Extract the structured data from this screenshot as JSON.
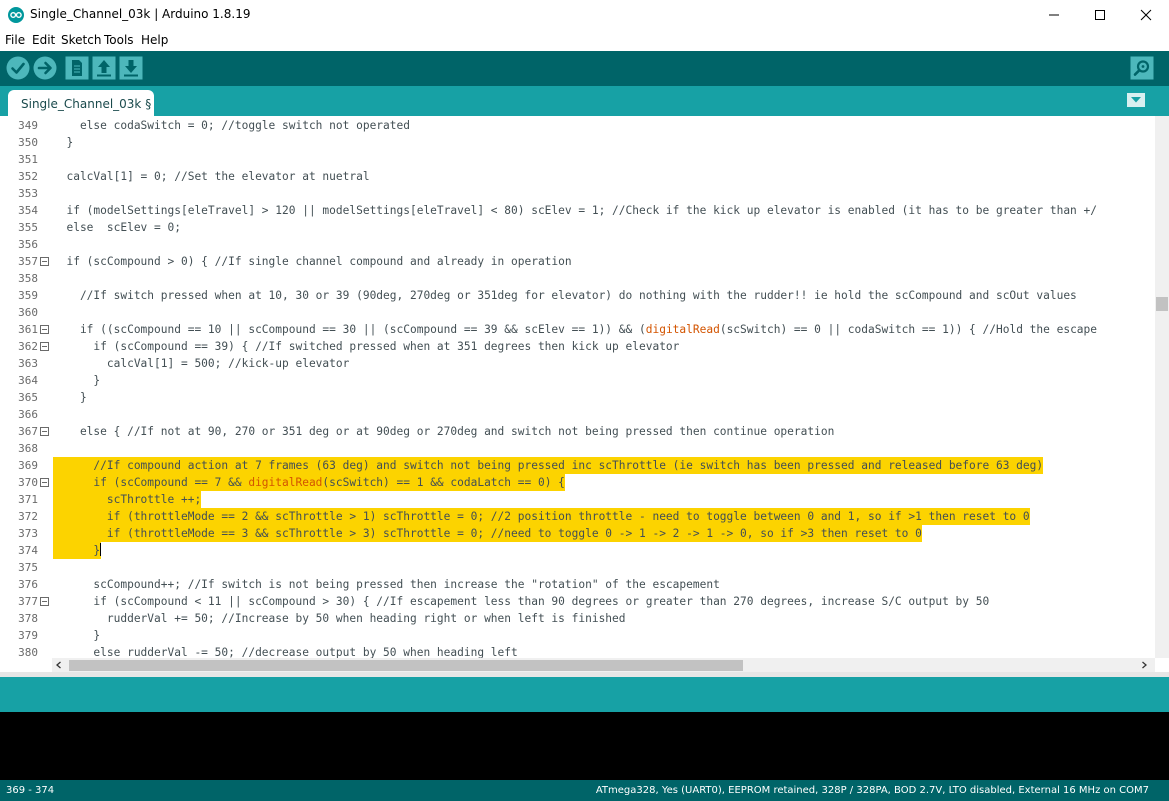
{
  "window": {
    "title": "Single_Channel_03k | Arduino 1.8.19",
    "app_icon": "arduino-logo-icon",
    "controls": [
      "minimize-icon",
      "maximize-icon",
      "close-icon"
    ]
  },
  "menu": {
    "items": [
      "File",
      "Edit",
      "Sketch",
      "Tools",
      "Help"
    ]
  },
  "toolbar": {
    "buttons": [
      {
        "name": "verify",
        "icon": "checkmark-icon"
      },
      {
        "name": "upload",
        "icon": "arrow-right-icon"
      },
      {
        "name": "new",
        "icon": "new-file-icon"
      },
      {
        "name": "open",
        "icon": "arrow-up-icon"
      },
      {
        "name": "save",
        "icon": "arrow-down-icon"
      }
    ],
    "serial_monitor_icon": "magnifier-icon"
  },
  "tabs": [
    {
      "label": "Single_Channel_03k §",
      "active": true
    }
  ],
  "editor": {
    "lines": [
      {
        "num": "349",
        "text": "    else codaSwitch = 0; //toggle switch not operated"
      },
      {
        "num": "350",
        "text": "  }"
      },
      {
        "num": "351",
        "text": ""
      },
      {
        "num": "352",
        "text": "  calcVal[1] = 0; //Set the elevator at nuetral"
      },
      {
        "num": "353",
        "text": ""
      },
      {
        "num": "354",
        "text": "  if (modelSettings[eleTravel] > 120 || modelSettings[eleTravel] < 80) scElev = 1; //Check if the kick up elevator is enabled (it has to be greater than +/"
      },
      {
        "num": "355",
        "text": "  else  scElev = 0;"
      },
      {
        "num": "356",
        "text": ""
      },
      {
        "num": "357",
        "text": "  if (scCompound > 0) { //If single channel compound and already in operation",
        "fold": true
      },
      {
        "num": "358",
        "text": ""
      },
      {
        "num": "359",
        "text": "    //If switch pressed when at 10, 30 or 39 (90deg, 270deg or 351deg for elevator) do nothing with the rudder!! ie hold the scCompound and scOut values"
      },
      {
        "num": "360",
        "text": ""
      },
      {
        "num": "361",
        "text": "    if ((scCompound == 10 || scCompound == 30 || (scCompound == 39 && scElev == 1)) && (digitalRead(scSwitch) == 0 || codaSwitch == 1)) { //Hold the escape",
        "fold": true
      },
      {
        "num": "362",
        "text": "      if (scCompound == 39) { //If switched pressed when at 351 degrees then kick up elevator",
        "fold": true
      },
      {
        "num": "363",
        "text": "        calcVal[1] = 500; //kick-up elevator"
      },
      {
        "num": "364",
        "text": "      }"
      },
      {
        "num": "365",
        "text": "    }"
      },
      {
        "num": "366",
        "text": ""
      },
      {
        "num": "367",
        "text": "    else { //If not at 90, 270 or 351 deg or at 90deg or 270deg and switch not being pressed then continue operation",
        "fold": true
      },
      {
        "num": "368",
        "text": ""
      },
      {
        "num": "369",
        "text": "      //If compound action at 7 frames (63 deg) and switch not being pressed inc scThrottle (ie switch has been pressed and released before 63 deg)",
        "hl": true
      },
      {
        "num": "370",
        "text": "      if (scCompound == 7 && digitalRead(scSwitch) == 1 && codaLatch == 0) {",
        "fold": true,
        "hl": true
      },
      {
        "num": "371",
        "text": "        scThrottle ++;",
        "hl": true
      },
      {
        "num": "372",
        "text": "        if (throttleMode == 2 && scThrottle > 1) scThrottle = 0; //2 position throttle - need to toggle between 0 and 1, so if >1 then reset to 0",
        "hl": true
      },
      {
        "num": "373",
        "text": "        if (throttleMode == 3 && scThrottle > 3) scThrottle = 0; //need to toggle 0 -> 1 -> 2 -> 1 -> 0, so if >3 then reset to 0",
        "hl": true
      },
      {
        "num": "374",
        "text": "      }",
        "hl": true,
        "caret": true
      },
      {
        "num": "375",
        "text": ""
      },
      {
        "num": "376",
        "text": "      scCompound++; //If switch is not being pressed then increase the \"rotation\" of the escapement"
      },
      {
        "num": "377",
        "text": "      if (scCompound < 11 || scCompound > 30) { //If escapement less than 90 degrees or greater than 270 degrees, increase S/C output by 50",
        "fold": true
      },
      {
        "num": "378",
        "text": "        rudderVal += 50; //Increase by 50 when heading right or when left is finished"
      },
      {
        "num": "379",
        "text": "      }"
      },
      {
        "num": "380",
        "text": "      else rudderVal -= 50; //decrease output by 50 when heading left"
      }
    ]
  },
  "status": {
    "lines": "369 - 374",
    "board": "ATmega328, Yes (UART0), EEPROM retained, 328P / 328PA, BOD 2.7V, LTO disabled, External 16 MHz on COM7"
  },
  "colors": {
    "toolbar": "#006468",
    "tabbar": "#17a1a5",
    "highlight": "#fcd300",
    "keyword": "#d35400"
  }
}
